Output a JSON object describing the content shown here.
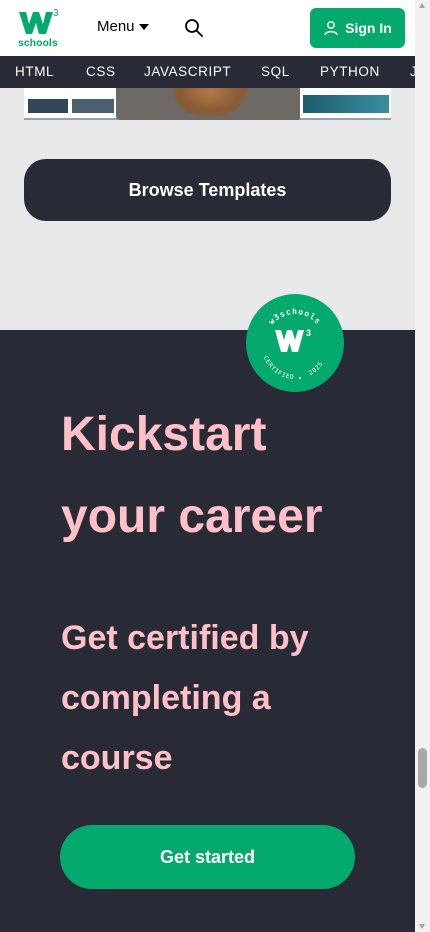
{
  "header": {
    "logo_superscript": "3",
    "logo_text": "schools",
    "menu_label": "Menu",
    "signin_label": "Sign In"
  },
  "lang_nav": {
    "items": [
      "HTML",
      "CSS",
      "JAVASCRIPT",
      "SQL",
      "PYTHON",
      "J"
    ]
  },
  "templates": {
    "browse_label": "Browse Templates"
  },
  "career": {
    "badge_top_text": "w3schools",
    "badge_bottom_left": "CERTIFIED",
    "badge_bottom_right": "2025",
    "badge_superscript": "3",
    "headline_line1": "Kickstart",
    "headline_line2": "your career",
    "sub_line1": "Get certified by",
    "sub_line2": "completing a",
    "sub_line3": "course",
    "cta_label": "Get started"
  },
  "colors": {
    "brand_green": "#04aa6d",
    "dark_bg": "#282a35",
    "light_bg": "#e7e9eb",
    "headline_pink": "#ffc0c7"
  },
  "icons": {
    "search": "search-icon",
    "user": "user-icon",
    "caret": "caret-down-icon"
  }
}
